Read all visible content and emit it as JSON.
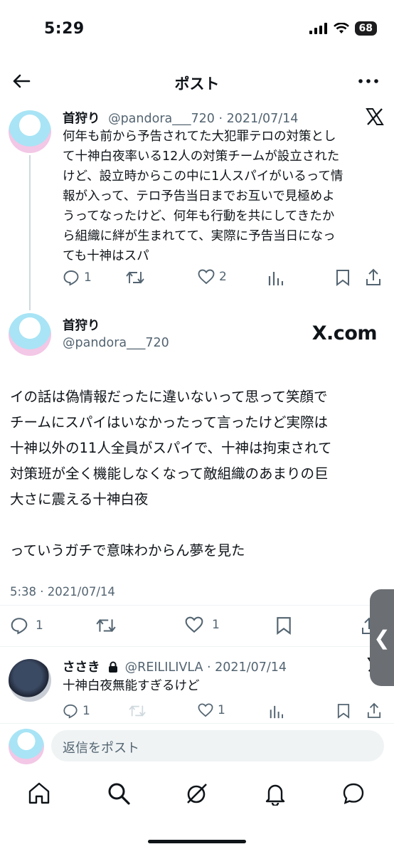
{
  "status_bar": {
    "time": "5:29",
    "battery": "68"
  },
  "header": {
    "title": "ポスト"
  },
  "tweet1": {
    "name": "首狩り",
    "handle_date": "@pandora___720 · 2021/07/14",
    "text_lines": [
      "何年も前から予告されてた大犯罪テロの対策とし",
      "て十神白夜率いる12人の対策チームが設立された",
      "けど、設立時からこの中に1人スパイがいるって情",
      "報が入って、テロ予告当日までお互いで見極めよ",
      "うってなったけど、何年も行動を共にしてきたか",
      "ら組織に絆が生まれてて、実際に予告当日になっ",
      "ても十神はスパ"
    ],
    "replies": "1",
    "likes": "2"
  },
  "tweet2": {
    "name": "首狩り",
    "handle": "@pandora___720",
    "brand": "X.com",
    "text_lines": [
      "イの話は偽情報だったに違いないって思って笑顔で",
      "チームにスパイはいなかったって言ったけど実際は",
      "十神以外の11人全員がスパイで、十神は拘束されて",
      "対策班が全く機能しなくなって敵組織のあまりの巨",
      "大さに震える十神白夜"
    ],
    "text_line2": "っていうガチで意味わからん夢を見た",
    "timestamp": "5:38 · 2021/07/14",
    "replies": "1",
    "likes": "1"
  },
  "tweet3": {
    "name": "ささき",
    "handle_date": "@REILILIVLA · 2021/07/14",
    "text": "十神白夜無能すぎるけど",
    "replies": "1",
    "likes": "1"
  },
  "reply_box": {
    "placeholder": "返信をポスト"
  },
  "side_tab": {
    "glyph": "❮"
  }
}
